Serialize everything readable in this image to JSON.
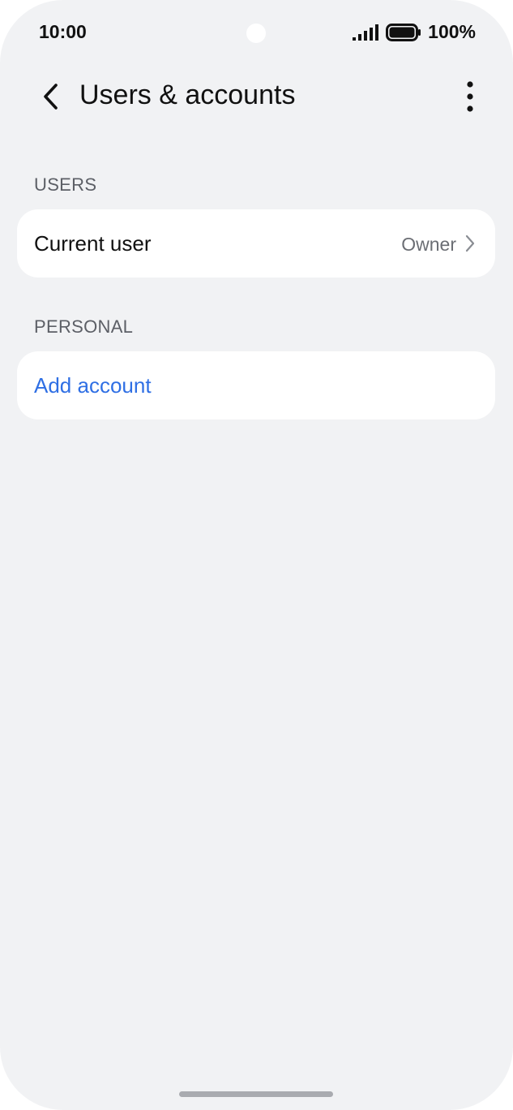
{
  "status_bar": {
    "time": "10:00",
    "battery": "100%",
    "icons": [
      "signal-icon",
      "battery-icon"
    ]
  },
  "header": {
    "title": "Users & accounts",
    "back_icon": "chevron-left-icon",
    "menu_icon": "more-vertical-icon"
  },
  "sections": {
    "users": {
      "label": "USERS",
      "items": [
        {
          "label": "Current user",
          "value": "Owner",
          "icon": "chevron-right-icon"
        }
      ]
    },
    "personal": {
      "label": "PERSONAL",
      "items": [
        {
          "label": "Add account"
        }
      ]
    }
  },
  "colors": {
    "background": "#f1f2f4",
    "card": "#ffffff",
    "link": "#2f6fe4",
    "text_primary": "#111111",
    "text_secondary": "#6b6e74"
  }
}
